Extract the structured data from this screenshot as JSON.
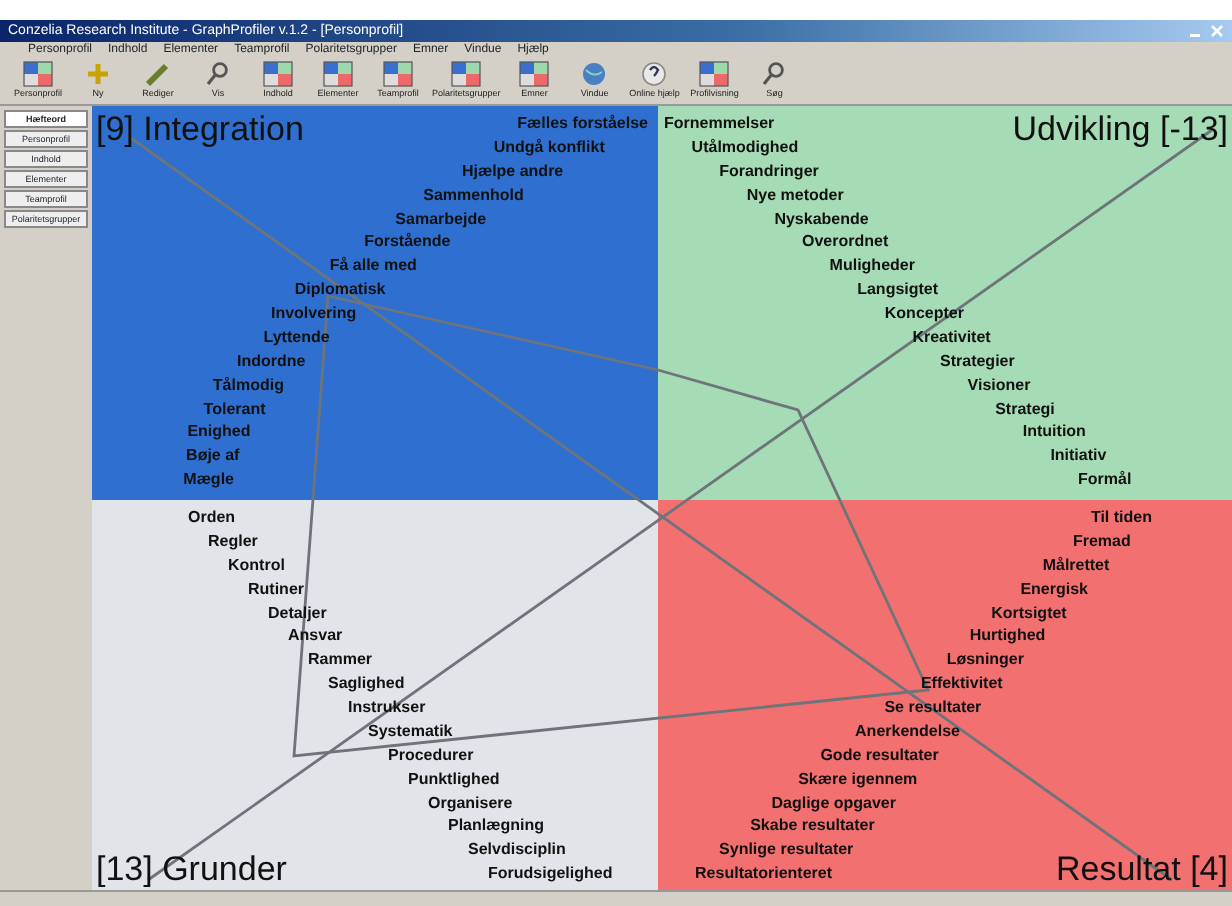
{
  "window": {
    "title": "Conzelia Research Institute - GraphProfiler v.1.2 - [Personprofil]"
  },
  "menu": [
    "Personprofil",
    "Indhold",
    "Elementer",
    "Teamprofil",
    "Polaritetsgrupper",
    "Emner",
    "Vindue",
    "Hjælp"
  ],
  "toolbar": [
    {
      "label": "Personprofil",
      "kind": "chart"
    },
    {
      "label": "Ny",
      "kind": "plus"
    },
    {
      "label": "Rediger",
      "kind": "pen"
    },
    {
      "label": "Vis",
      "kind": "magnifier"
    },
    {
      "label": "Indhold",
      "kind": "chart"
    },
    {
      "label": "Elementer",
      "kind": "chart"
    },
    {
      "label": "Teamprofil",
      "kind": "chart"
    },
    {
      "label": "Polaritetsgrupper",
      "kind": "chart"
    },
    {
      "label": "Emner",
      "kind": "chart"
    },
    {
      "label": "Vindue",
      "kind": "globe"
    },
    {
      "label": "Online hjælp",
      "kind": "help"
    },
    {
      "label": "Profilvisning",
      "kind": "chart"
    },
    {
      "label": "Søg",
      "kind": "magnifier"
    }
  ],
  "sidebar": {
    "items": [
      {
        "label": "Hæfteord",
        "selected": true
      },
      {
        "label": "Personprofil",
        "selected": false
      },
      {
        "label": "Indhold",
        "selected": false
      },
      {
        "label": "Elementer",
        "selected": false
      },
      {
        "label": "Teamprofil",
        "selected": false
      },
      {
        "label": "Polaritetsgrupper",
        "selected": false
      }
    ]
  },
  "quadrants": [
    {
      "title": "[9] Integration",
      "color": "#2f6fd0",
      "words": [
        "Fælles forståelse",
        "Undgå konflikt",
        "Hjælpe andre",
        "Sammenhold",
        "Samarbejde",
        "Forstående",
        "Få alle med",
        "Diplomatisk",
        "Involvering",
        "Lyttende",
        "Indordne",
        "Tålmodig",
        "Tolerant",
        "Enighed",
        "Bøje af",
        "Mægle"
      ]
    },
    {
      "title": "Udvikling [-13]",
      "color": "#a6dcb5",
      "words": [
        "Fornemmelser",
        "Utålmodighed",
        "Forandringer",
        "Nye metoder",
        "Nyskabende",
        "Overordnet",
        "Muligheder",
        "Langsigtet",
        "Koncepter",
        "Kreativitet",
        "Strategier",
        "Visioner",
        "Strategi",
        "Intuition",
        "Initiativ",
        "Formål"
      ]
    },
    {
      "title": "[13] Grunder",
      "color": "#e1e5e9",
      "words": [
        "Orden",
        "Regler",
        "Kontrol",
        "Rutiner",
        "Detaljer",
        "Ansvar",
        "Rammer",
        "Saglighed",
        "Instrukser",
        "Systematik",
        "Procedurer",
        "Punktlighed",
        "Organisere",
        "Planlægning",
        "Selvdisciplin",
        "Forudsigelighed"
      ]
    },
    {
      "title": "Resultat [4]",
      "color": "#f27070",
      "words": [
        "Til tiden",
        "Fremad",
        "Målrettet",
        "Energisk",
        "Kortsigtet",
        "Hurtighed",
        "Løsninger",
        "Effektivitet",
        "Se resultater",
        "Anerkendelse",
        "Gode resultater",
        "Skære igennem",
        "Daglige opgaver",
        "Skabe resultater",
        "Synlige resultater",
        "Resultatorienteret"
      ]
    }
  ]
}
